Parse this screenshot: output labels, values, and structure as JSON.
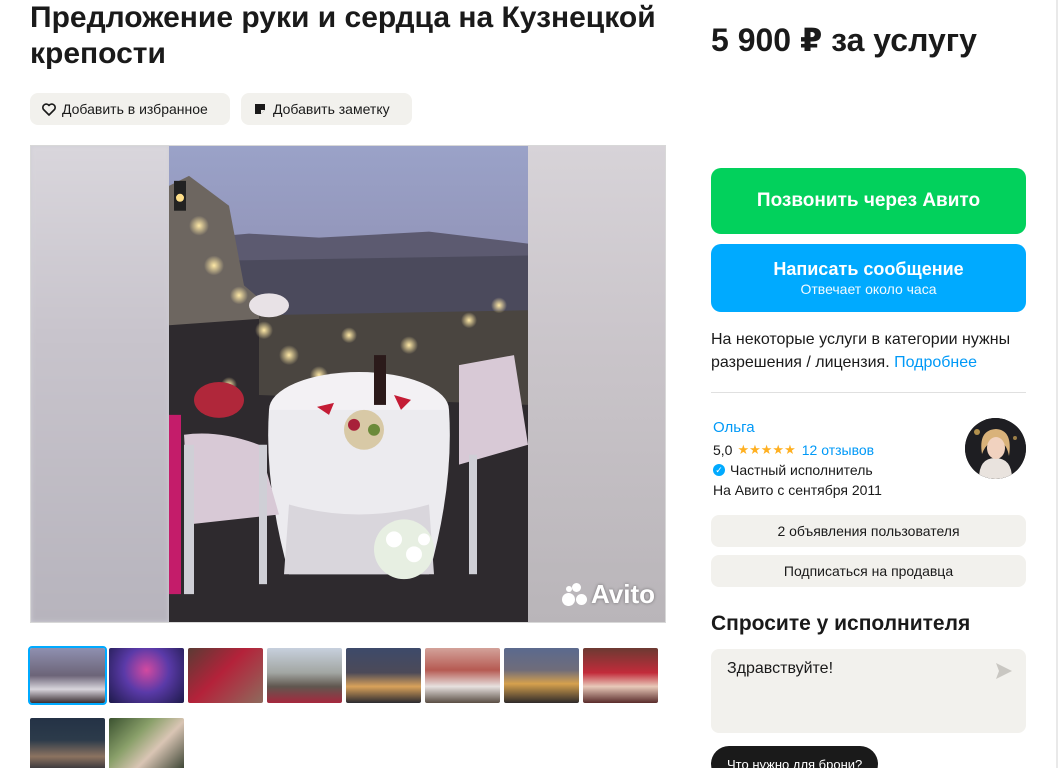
{
  "listing": {
    "title": "Предложение руки и сердца на Кузнецкой крепости",
    "price": "5 900 ₽ за услугу"
  },
  "actions": {
    "favorite_label": "Добавить в избранное",
    "note_label": "Добавить заметку"
  },
  "gallery": {
    "watermark": "Avito",
    "thumbnail_count": 10,
    "active_thumbnail": 1
  },
  "contact": {
    "call_label": "Позвонить через Авито",
    "message_label": "Написать сообщение",
    "message_sub": "Отвечает около часа"
  },
  "license": {
    "text": "На некоторые услуги в категории нужны разрешения / лицензия. ",
    "link": "Подробнее"
  },
  "seller": {
    "name": "Ольга",
    "rating": "5,0",
    "stars": "★★★★★",
    "reviews": "12 отзывов",
    "type": "Частный исполнитель",
    "since": "На Авито с сентября 2011"
  },
  "seller_buttons": {
    "listings": "2 объявления пользователя",
    "subscribe": "Подписаться на продавца"
  },
  "ask": {
    "title": "Спросите у исполнителя",
    "input_value": "Здравствуйте!",
    "chip": "Что нужно для брони?"
  },
  "colors": {
    "green": "#02d15c",
    "blue": "#00aaff",
    "link": "#0099f7",
    "star": "#ffb021",
    "pill_bg": "#f2f1ed"
  }
}
